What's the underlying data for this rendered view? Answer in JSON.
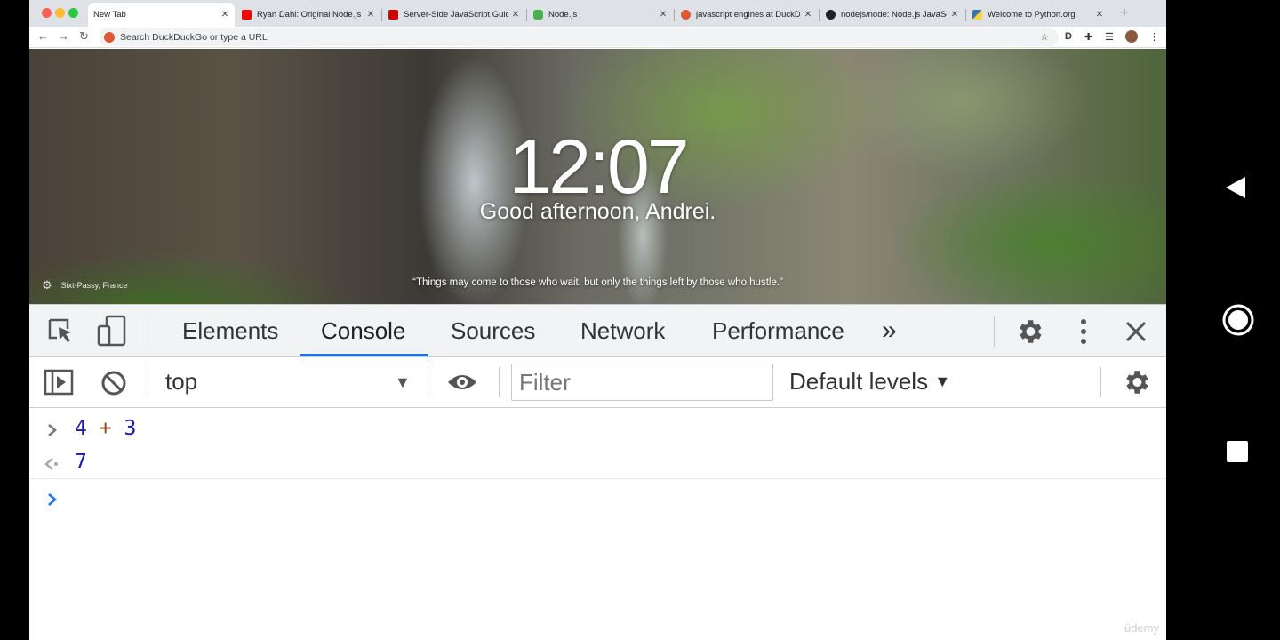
{
  "tabs": [
    {
      "title": "New Tab",
      "active": true,
      "favicon_color": "#ffffff"
    },
    {
      "title": "Ryan Dahl: Original Node.js p",
      "favicon_color": "#ff0000"
    },
    {
      "title": "Server-Side JavaScript Guide",
      "favicon_color": "#cc0000"
    },
    {
      "title": "Node.js",
      "favicon_color": "#4caf50"
    },
    {
      "title": "javascript engines at DuckDu",
      "favicon_color": "#de5833"
    },
    {
      "title": "nodejs/node: Node.js JavaSc",
      "favicon_color": "#202124"
    },
    {
      "title": "Welcome to Python.org",
      "favicon_color": "#3776ab"
    }
  ],
  "omnibox": {
    "placeholder": "Search DuckDuckGo or type a URL"
  },
  "hero": {
    "clock": "12:07",
    "greeting": "Good afternoon, Andrei.",
    "quote": "“Things may come to those who wait, but only the things left by those who hustle.”",
    "location": "Sixt-Passy, France"
  },
  "devtools": {
    "tabs": [
      "Elements",
      "Console",
      "Sources",
      "Network",
      "Performance"
    ],
    "active_tab": "Console",
    "more_tabs": "»",
    "context": "top",
    "filter_placeholder": "Filter",
    "levels": "Default levels",
    "accent": "#1a73e8"
  },
  "console": {
    "input_left": "4",
    "input_op": "+",
    "input_right": "3",
    "result": "7"
  },
  "watermark": "ûdemy"
}
